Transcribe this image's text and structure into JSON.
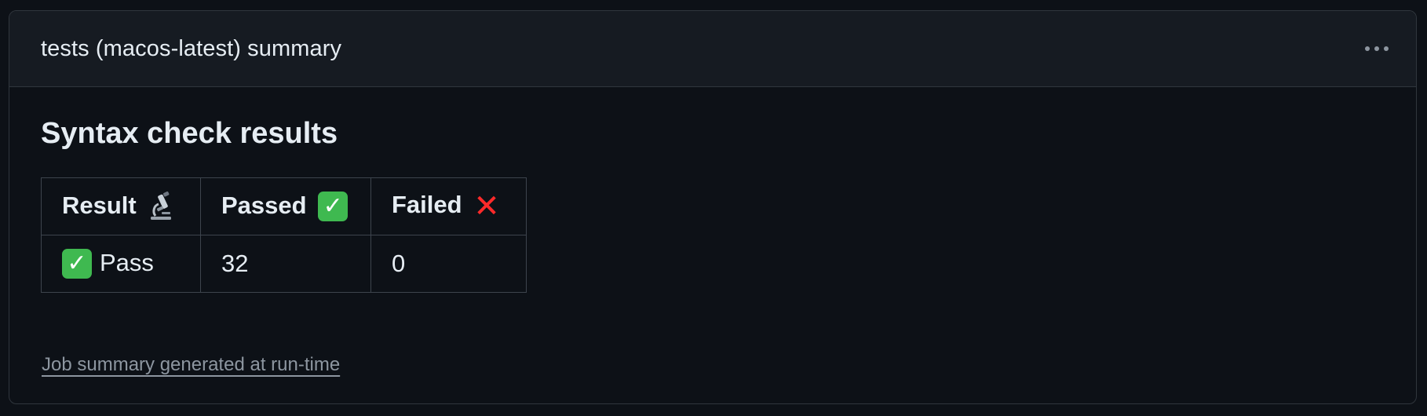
{
  "header": {
    "title": "tests (macos-latest) summary",
    "menu_icon": "kebab-horizontal-icon"
  },
  "body": {
    "section_title": "Syntax check results",
    "table": {
      "columns": [
        {
          "label": "Result",
          "icon": "microscope-icon"
        },
        {
          "label": "Passed",
          "icon": "check-mark-button-icon"
        },
        {
          "label": "Failed",
          "icon": "cross-mark-icon"
        }
      ],
      "rows": [
        {
          "result_icon": "check-mark-button-icon",
          "result": "Pass",
          "passed": "32",
          "failed": "0"
        }
      ]
    },
    "footer_link": "Job summary generated at run-time"
  },
  "colors": {
    "background": "#0d1117",
    "header_background": "#161b22",
    "border": "#30363d",
    "text": "#e6edf3",
    "muted_text": "#8d96a0",
    "check_green": "#3fb950",
    "cross_red": "#ff2a2a"
  }
}
